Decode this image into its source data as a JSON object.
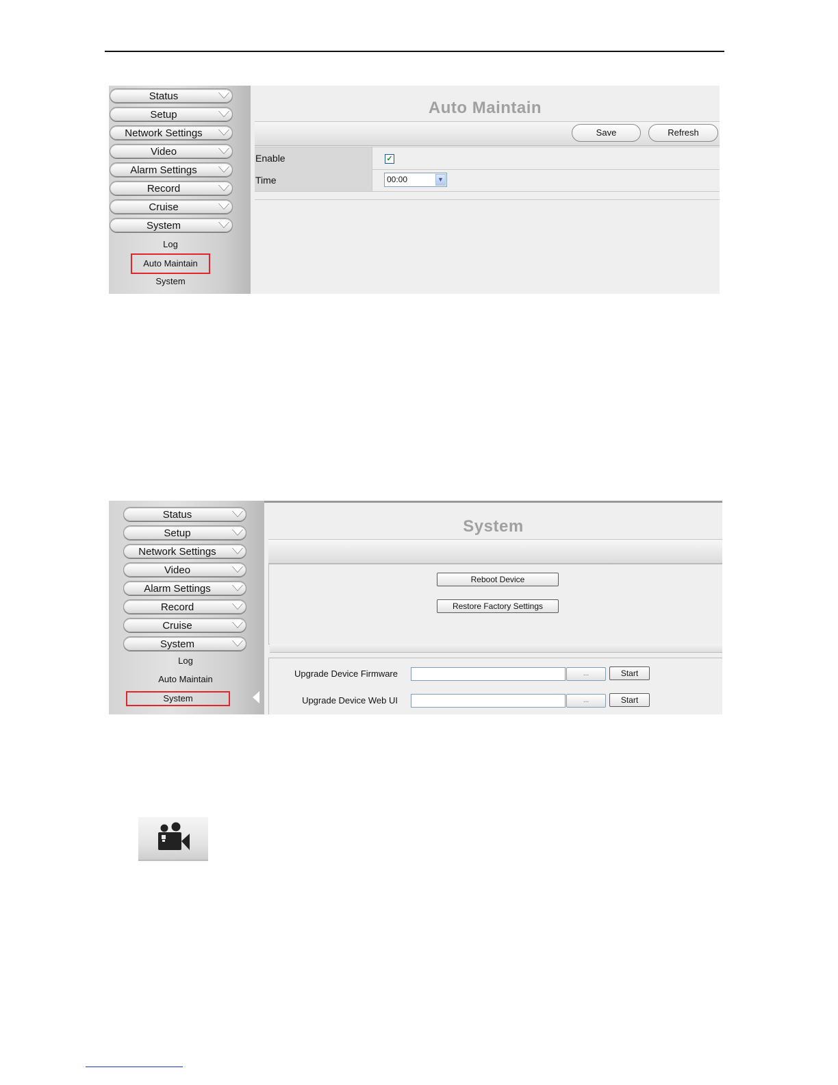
{
  "auto_maintain_shot": {
    "menu": [
      "Status",
      "Setup",
      "Network Settings",
      "Video",
      "Alarm Settings",
      "Record",
      "Cruise",
      "System"
    ],
    "submenu": [
      "Log",
      "Auto Maintain",
      "System"
    ],
    "selected_submenu": "Auto Maintain",
    "title": "Auto Maintain",
    "save_label": "Save",
    "refresh_label": "Refresh",
    "enable_label": "Enable",
    "enable_checked": true,
    "time_label": "Time",
    "time_value": "00:00"
  },
  "system_shot": {
    "menu": [
      "Status",
      "Setup",
      "Network Settings",
      "Video",
      "Alarm Settings",
      "Record",
      "Cruise",
      "System"
    ],
    "submenu": [
      "Log",
      "Auto Maintain",
      "System"
    ],
    "selected_submenu": "System",
    "title": "System",
    "reboot_label": "Reboot Device",
    "restore_label": "Restore Factory Settings",
    "firmware_label": "Upgrade Device Firmware",
    "webui_label": "Upgrade Device Web UI",
    "browse_label": "...",
    "start_label": "Start"
  },
  "icons": {
    "record_icon": "video-camera-icon",
    "highlight_color": "#e0262a"
  }
}
